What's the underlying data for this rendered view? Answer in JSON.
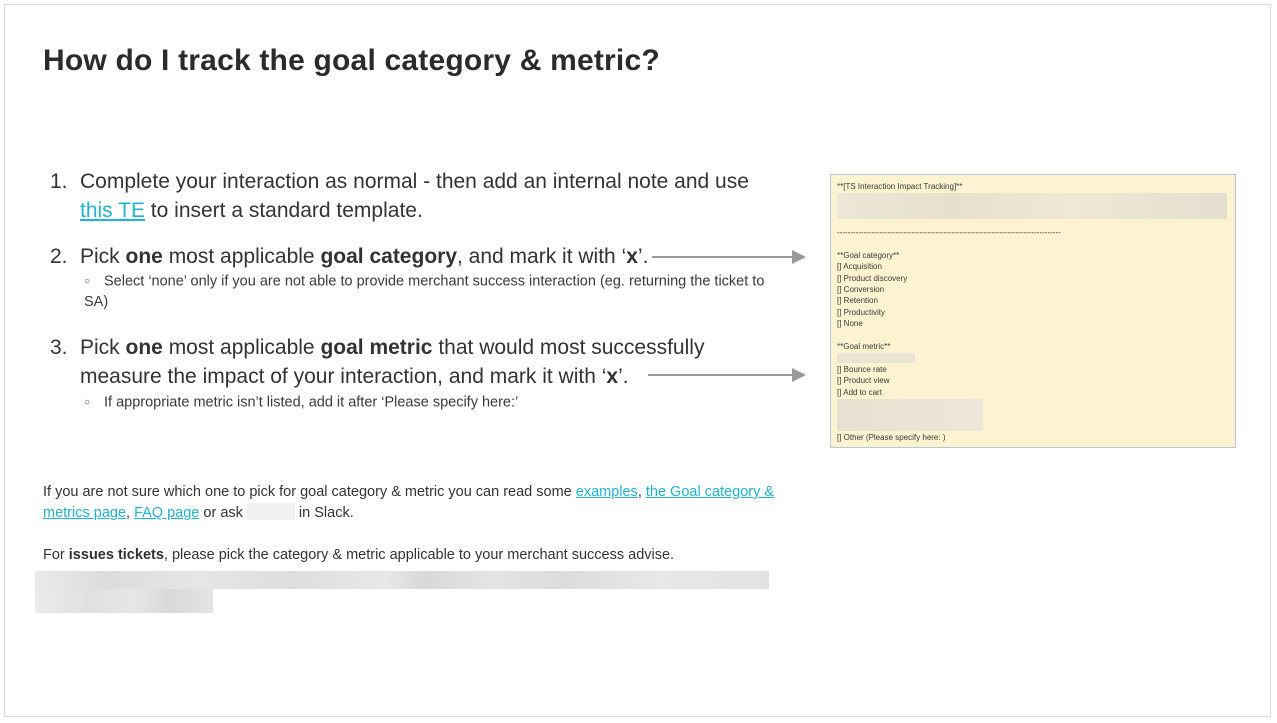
{
  "title": "How do I track the goal category & metric?",
  "steps": {
    "s1": {
      "num": "1.",
      "text1": "Complete your interaction as normal - then add an internal note and use",
      "link": "this TE",
      "text2": " to insert a standard template."
    },
    "s2": {
      "num": "2.",
      "t1": "Pick ",
      "b1": "one",
      "t2": " most applicable ",
      "b2": "goal category",
      "t3": ", and mark it with ‘",
      "b3": "x",
      "t4": "’.",
      "sub": "Select ‘none’ only if you are not able to provide merchant success interaction (eg. returning the ticket to SA)"
    },
    "s3": {
      "num": "3.",
      "t1": "Pick ",
      "b1": "one",
      "t2": " most applicable ",
      "b2": "goal metric",
      "t3": " that would most successfully",
      "line2a": "measure the impact of your interaction, and mark it with ‘",
      "b3": "x",
      "t4": "’.",
      "sub": "If appropriate metric isn’t listed, add it after ‘Please specify here:’"
    }
  },
  "bullet": "○",
  "template": {
    "header": "**[TS Interaction Impact Tracking]**",
    "divider": "------------------------------------------------------------------------------------",
    "category_heading": "**Goal category**",
    "categories": [
      "[] Acquisition",
      "[] Product discovery",
      "[] Conversion",
      "[] Retention",
      "[] Productivity",
      "[] None"
    ],
    "metric_heading": "**Goal metric**",
    "metrics": [
      "[] Bounce rate",
      "[] Product view",
      "[] Add to cart"
    ],
    "other": "[] Other (Please specify here: )"
  },
  "footer": {
    "p1_a": "If you are not sure which one to pick for goal category & metric you can read some ",
    "link_examples": "examples",
    "comma": ", ",
    "link_goal_page": "the Goal category & metrics page",
    "comma2": ", ",
    "link_faq": "FAQ page",
    "p1_b": " or ask",
    "p1_c": " in Slack.",
    "p2_a": "For ",
    "p2_bold": "issues tickets",
    "p2_b": ", please pick the category & metric applicable to your merchant success advise."
  },
  "colors": {
    "link": "#1fb4d4",
    "card_bg": "#fdf3d1",
    "arrow": "#9a9a9a"
  }
}
